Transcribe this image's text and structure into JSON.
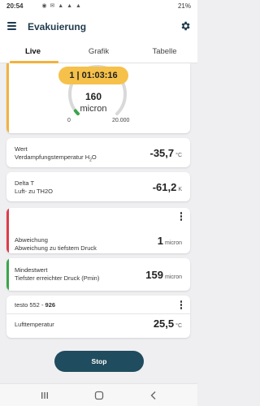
{
  "status_bar": {
    "time": "20:54",
    "battery": "21%"
  },
  "app_bar": {
    "title": "Evakuierung"
  },
  "tabs": [
    {
      "label": "Live",
      "active": true
    },
    {
      "label": "Grafik",
      "active": false
    },
    {
      "label": "Tabelle",
      "active": false
    }
  ],
  "gauge": {
    "timer": "1 | 01:03:16",
    "value": "160",
    "unit": "micron",
    "min": "0",
    "max": "20.000",
    "fraction": 0.008,
    "accent_color": "#f4b23c"
  },
  "cards": {
    "wert": {
      "line1": "Wert",
      "line2_prefix": "Verdampfungstemperatur H",
      "line2_sub": "2",
      "line2_suffix": "O",
      "value": "-35,7",
      "unit": "°C"
    },
    "delta": {
      "line1": "Delta T",
      "line2": "Luft- zu TH2O",
      "value": "-61,2",
      "unit": "K"
    },
    "abweichung": {
      "line1": "Abweichung",
      "line2": "Abweichung zu tiefstem Druck",
      "value": "1",
      "unit": "micron",
      "accent_color": "#e03c4a"
    },
    "mindestwert": {
      "line1": "Mindestwert",
      "line2": "Tiefster erreichter Druck (Pmin)",
      "value": "159",
      "unit": "micron",
      "accent_color": "#3aa64a"
    },
    "testo": {
      "device": "testo 552",
      "separator": " - ",
      "serial": "926",
      "label": "Lufttemperatur",
      "value": "25,5",
      "unit": "°C"
    }
  },
  "stop_button": {
    "label": "Stop"
  },
  "colors": {
    "primary": "#1f4c5e",
    "accent": "#f4b23c"
  }
}
